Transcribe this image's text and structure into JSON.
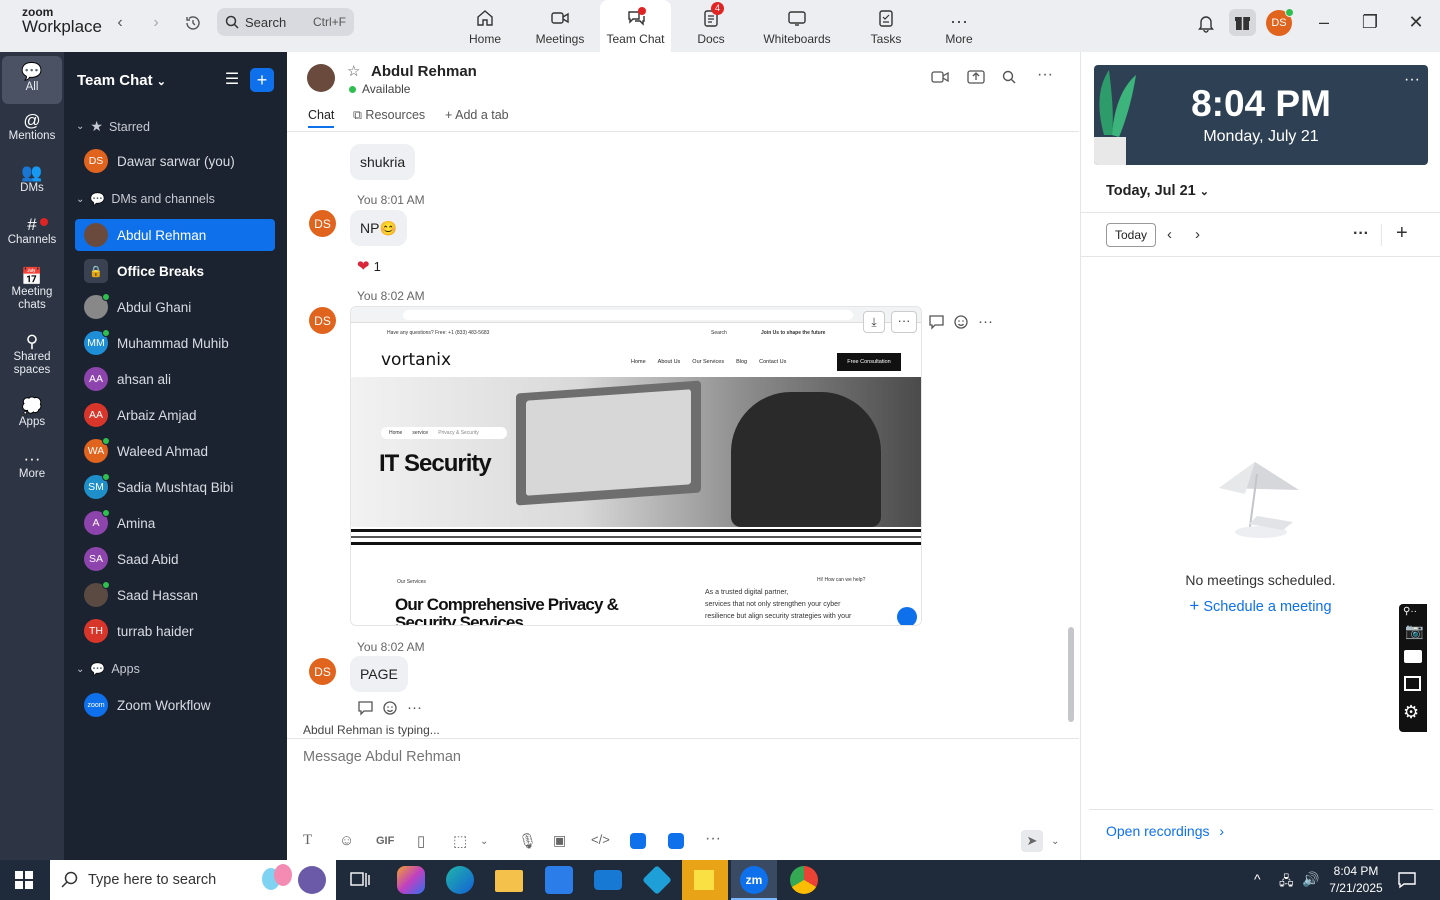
{
  "app": {
    "logo_top": "zoom",
    "logo_bottom": "Workplace"
  },
  "search": {
    "label": "Search",
    "shortcut": "Ctrl+F"
  },
  "tabs": [
    {
      "label": "Home"
    },
    {
      "label": "Meetings"
    },
    {
      "label": "Team Chat"
    },
    {
      "label": "Docs",
      "badge": "4"
    },
    {
      "label": "Whiteboards"
    },
    {
      "label": "Tasks"
    },
    {
      "label": "More"
    }
  ],
  "user": {
    "initials": "DS"
  },
  "rail": [
    {
      "label": "All"
    },
    {
      "label": "Mentions"
    },
    {
      "label": "DMs"
    },
    {
      "label": "Channels"
    },
    {
      "label": "Meeting chats"
    },
    {
      "label": "Shared spaces"
    },
    {
      "label": "Apps"
    },
    {
      "label": "More"
    }
  ],
  "sidebar": {
    "title": "Team Chat",
    "starred_label": "Starred",
    "starred": [
      {
        "name": "Dawar sarwar (you)",
        "initials": "DS"
      }
    ],
    "dms_label": "DMs and channels",
    "items": [
      {
        "name": "Abdul Rehman"
      },
      {
        "name": "Office Breaks"
      },
      {
        "name": "Abdul Ghani"
      },
      {
        "name": "Muhammad Muhib",
        "initials": "MM"
      },
      {
        "name": "ahsan ali",
        "initials": "AA"
      },
      {
        "name": "Arbaiz Amjad",
        "initials": "AA"
      },
      {
        "name": "Waleed Ahmad",
        "initials": "WA"
      },
      {
        "name": "Sadia Mushtaq Bibi",
        "initials": "SM"
      },
      {
        "name": "Amina",
        "initials": "A"
      },
      {
        "name": "Saad Abid",
        "initials": "SA"
      },
      {
        "name": "Saad Hassan"
      },
      {
        "name": "turrab haider",
        "initials": "TH"
      }
    ],
    "apps_label": "Apps",
    "apps": [
      {
        "name": "Zoom Workflow",
        "logo": "zoom"
      }
    ]
  },
  "chat": {
    "contact": "Abdul Rehman",
    "status": "Available",
    "tabs": [
      "Chat",
      "Resources",
      "Add a tab"
    ],
    "messages": [
      {
        "text": "shukria"
      },
      {
        "meta": "You 8:01 AM",
        "initials": "DS",
        "text": "NP",
        "reaction_count": "1"
      },
      {
        "meta": "You 8:02 AM",
        "initials": "DS"
      },
      {
        "meta": "You 8:02 AM",
        "initials": "DS",
        "text": "PAGE"
      }
    ],
    "typing_name": "Abdul Rehman",
    "typing_suffix": "is typing...",
    "composer_placeholder": "Message Abdul Rehman",
    "gif_label": "GIF"
  },
  "screenshot_site": {
    "topline": "Have any questions? Free: +1 (833) 483-5683",
    "search": "Search",
    "join": "Join Us to shape the future",
    "brand": "vortanix",
    "nav": [
      "Home",
      "About Us",
      "Our Services",
      "Blog",
      "Contact Us"
    ],
    "cta": "Free Consultation",
    "crumbs": [
      "Home",
      "service",
      "Privacy & Security"
    ],
    "hero": "IT Security",
    "services_tag": "Our Services",
    "help": "Hi! How can we help?",
    "heading_line1": "Our Comprehensive Privacy &",
    "heading_line2": "Security Services",
    "para1": "As a trusted digital partner,",
    "para2": "services that not only strengthen your cyber",
    "para3": "resilience but align security strategies with your"
  },
  "calendar": {
    "time": "8:04 PM",
    "date": "Monday, July 21",
    "day_label": "Today, Jul 21",
    "today_btn": "Today",
    "empty": "No meetings scheduled.",
    "schedule": "Schedule a meeting",
    "recordings": "Open recordings"
  },
  "taskbar": {
    "search": "Type here to search",
    "time": "8:04 PM",
    "date": "7/21/2025",
    "zoom_label": "zm"
  },
  "colors": {
    "accent": "#0e71eb",
    "sidebar": "#1c2330",
    "rail": "#2d3544",
    "avatar_orange": "#e0641e"
  }
}
